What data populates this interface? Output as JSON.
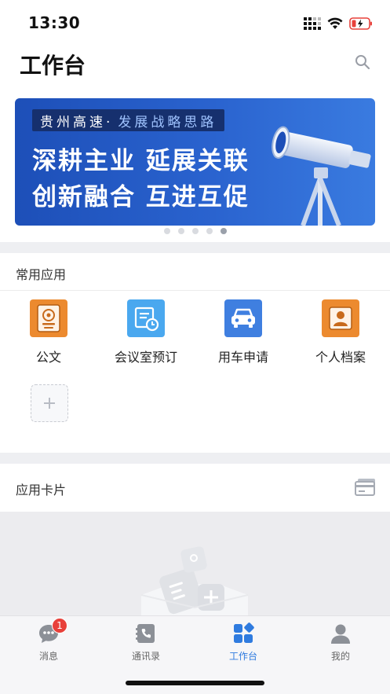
{
  "status_bar": {
    "time": "13:30"
  },
  "header": {
    "title": "工作台",
    "search_icon": "search-icon"
  },
  "banner": {
    "tag_main": "贵州高速·",
    "tag_sub": "发展战略思路",
    "line1": "深耕主业  延展关联",
    "line2": "创新融合  互进互促",
    "page_count": 5,
    "active_page": 5
  },
  "common_apps": {
    "title": "常用应用",
    "items": [
      {
        "label": "公文",
        "icon": "document-seal-icon",
        "color": "#ec8a2f"
      },
      {
        "label": "会议室预订",
        "icon": "meeting-booking-icon",
        "color": "#4aa8ef"
      },
      {
        "label": "用车申请",
        "icon": "car-icon",
        "color": "#3f7fe0"
      },
      {
        "label": "个人档案",
        "icon": "profile-icon",
        "color": "#ec8a2f"
      }
    ],
    "add_icon": "plus-icon"
  },
  "app_cards": {
    "title": "应用卡片",
    "icon": "card-icon"
  },
  "tabbar": {
    "items": [
      {
        "label": "消息",
        "icon": "chat-icon",
        "badge": "1"
      },
      {
        "label": "通讯录",
        "icon": "contacts-phone-icon"
      },
      {
        "label": "工作台",
        "icon": "workbench-grid-icon",
        "active": true
      },
      {
        "label": "我的",
        "icon": "user-icon"
      }
    ]
  },
  "colors": {
    "accent": "#2f7bdf",
    "badge": "#e8403a",
    "banner_blue": "#2a63cf"
  }
}
